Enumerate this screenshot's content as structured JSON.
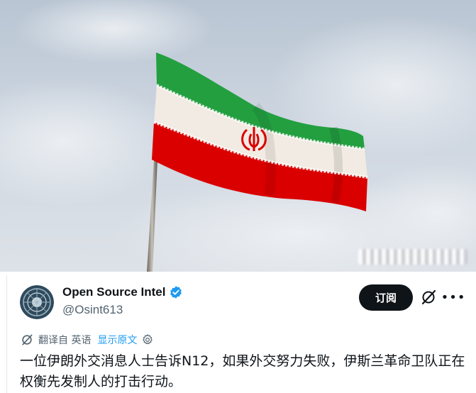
{
  "photo": {
    "subject": "iran-flag",
    "colors": {
      "sky": "#c7d0dc",
      "green": "#239f40",
      "white": "#f1ebe3",
      "red": "#da0000"
    }
  },
  "tweet": {
    "author_name": "Open Source Intel",
    "handle": "@Osint613",
    "verified": true,
    "subscribe_label": "订阅",
    "more_label": "•••",
    "translated_label": "翻译自 英语",
    "show_original_label": "显示原文",
    "text": "一位伊朗外交消息人士告诉N12，如果外交努力失败，伊斯兰革命卫队正在权衡先发制人的打击行动。"
  },
  "icons": {
    "verified": "verified-badge-icon",
    "grok": "grok-icon",
    "more": "more-icon",
    "translate": "translate-icon",
    "settings": "gear-icon"
  },
  "accent": "#1d9bf0"
}
